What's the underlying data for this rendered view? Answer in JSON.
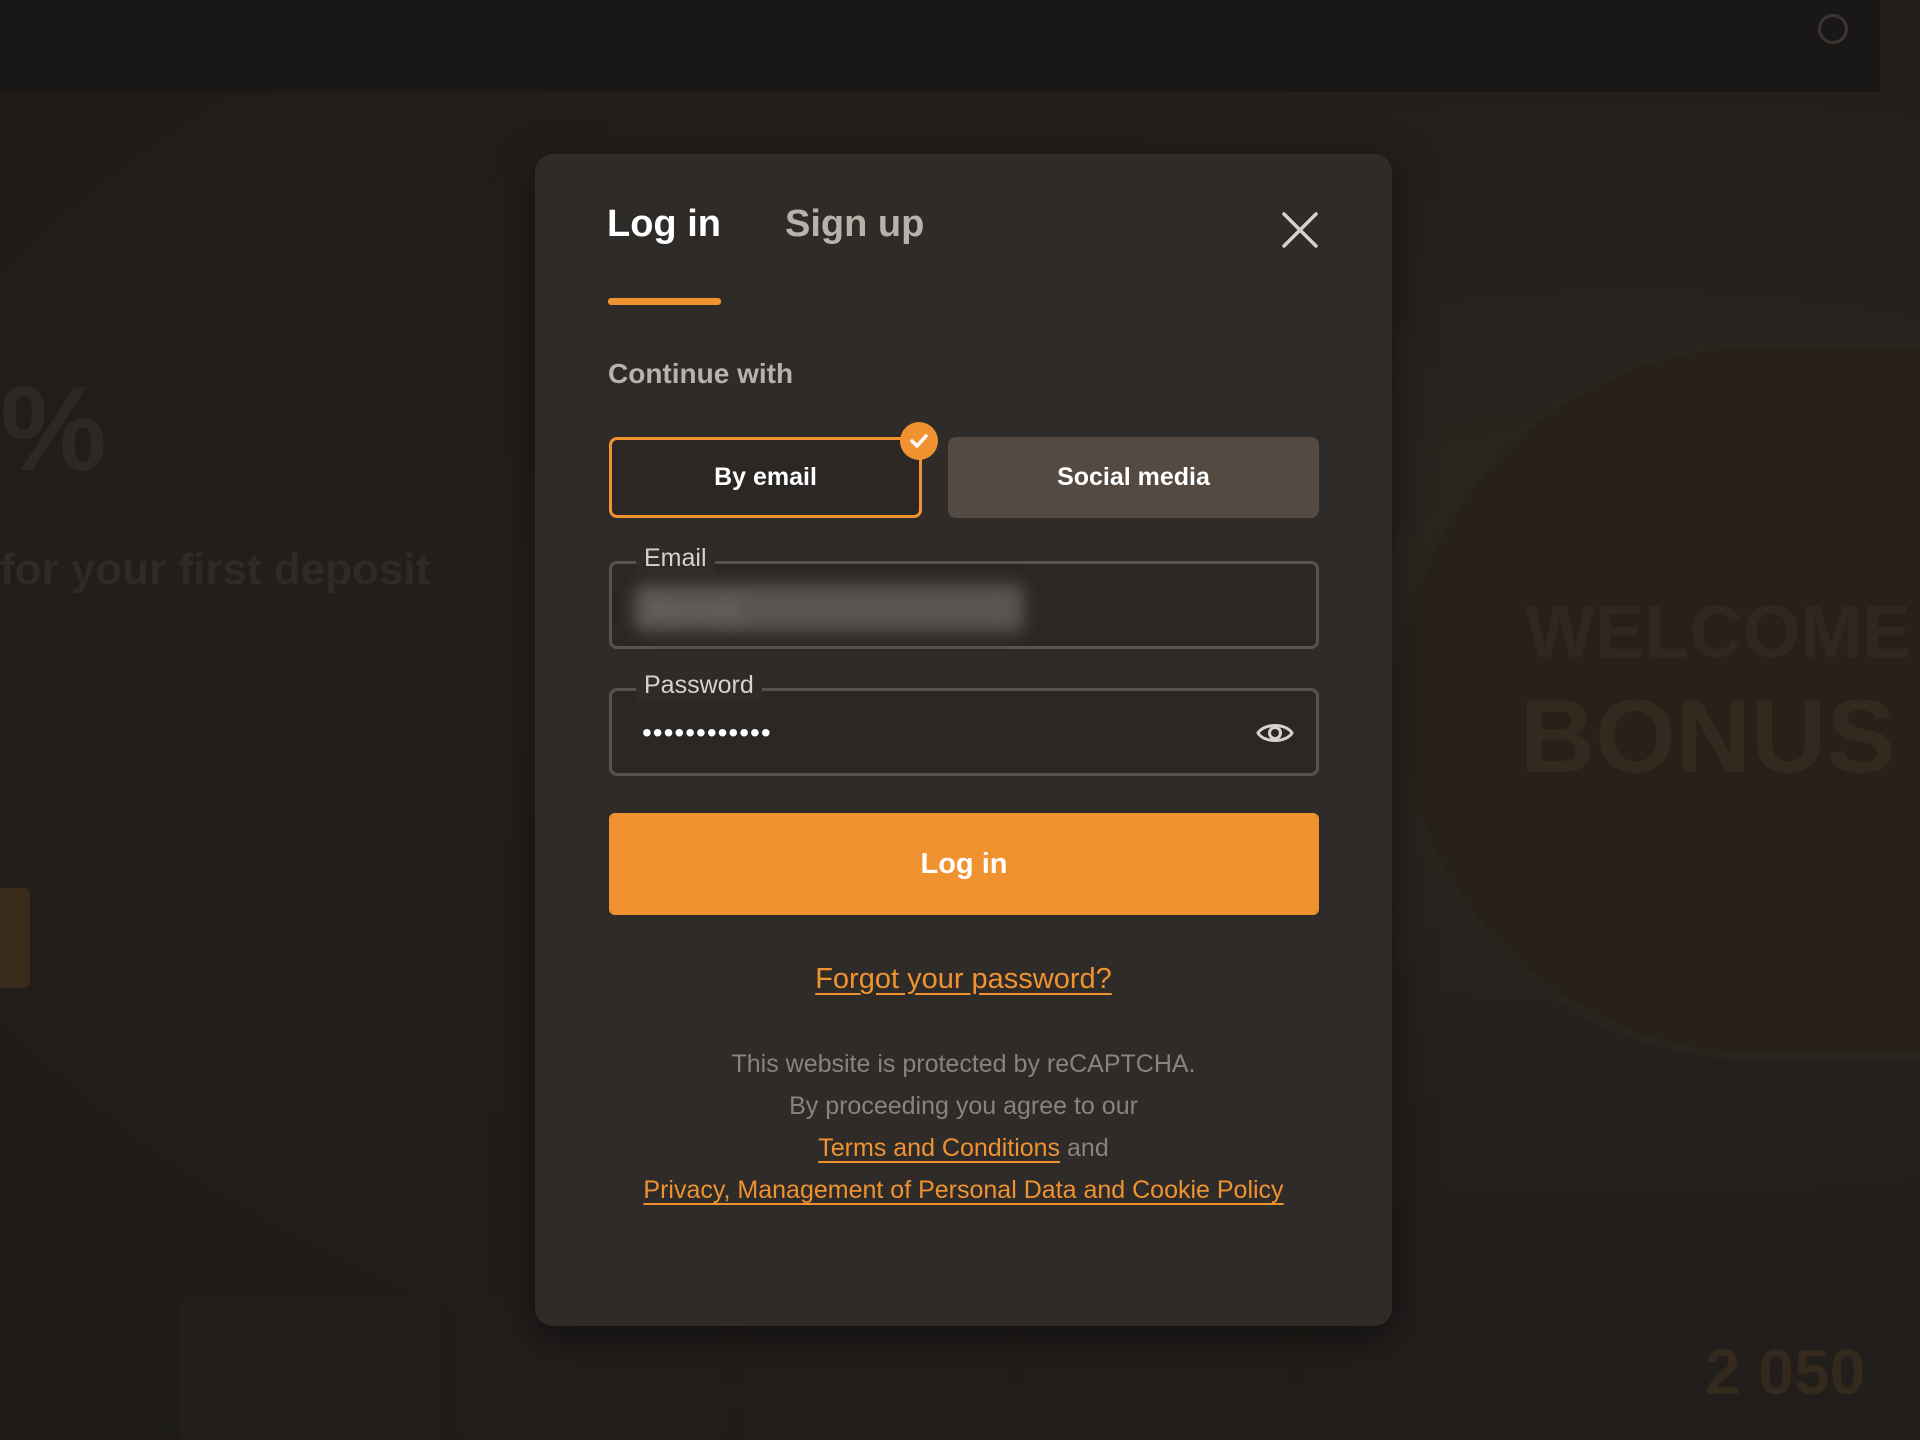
{
  "background": {
    "promo_percent": "%",
    "promo_text": "for your first deposit",
    "welcome": "WELCOME",
    "bonus": "BONUS",
    "amount": "2 050"
  },
  "modal": {
    "tabs": [
      {
        "label": "Log in",
        "active": true
      },
      {
        "label": "Sign up",
        "active": false
      }
    ],
    "continue_with": "Continue with",
    "options": {
      "email": "By email",
      "social": "Social media",
      "selected": "email"
    },
    "email": {
      "label": "Email",
      "value": "[blurred]"
    },
    "password": {
      "label": "Password",
      "value": "••••••••••••"
    },
    "login_button": "Log in",
    "forgot": "Forgot your password?",
    "legal": {
      "line1": "This website is protected by reCAPTCHA.",
      "line2": "By proceeding you agree to our",
      "terms": "Terms and Conditions",
      "and": "and",
      "privacy": "Privacy, Management of Personal Data and Cookie Policy"
    }
  },
  "colors": {
    "accent": "#f0922f",
    "modal_bg": "#2e2b29",
    "page_bg": "#221e1c"
  }
}
